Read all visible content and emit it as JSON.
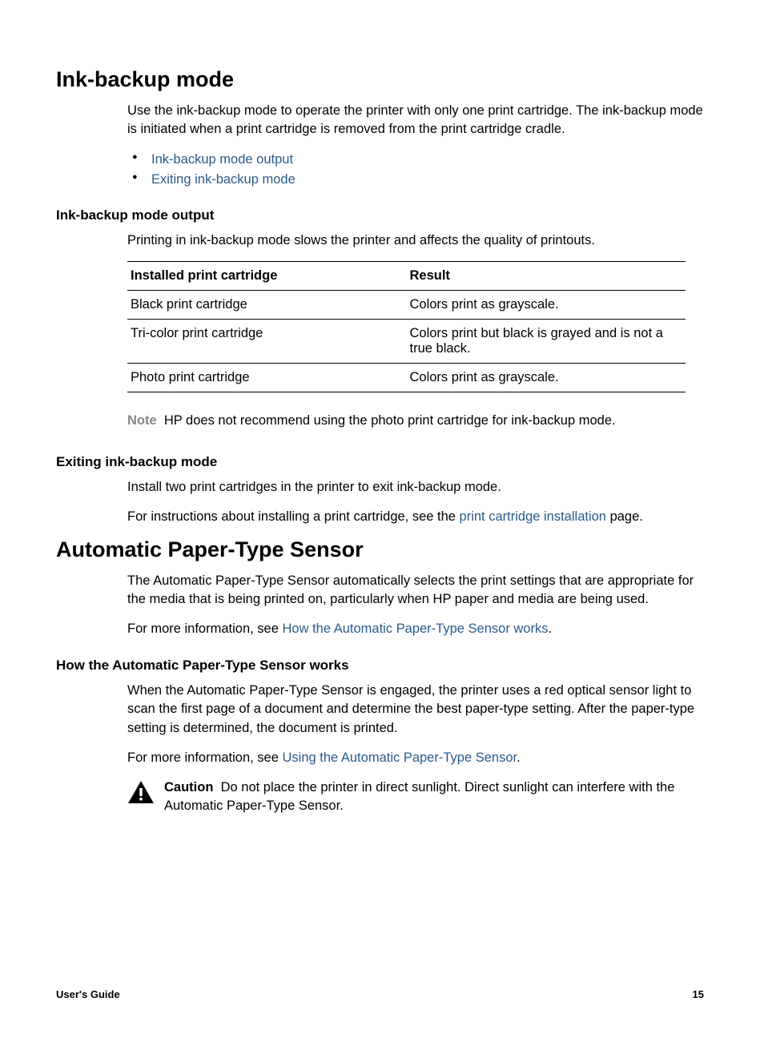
{
  "section1": {
    "title": "Ink-backup mode",
    "intro": "Use the ink-backup mode to operate the printer with only one print cartridge. The ink-backup mode is initiated when a print cartridge is removed from the print cartridge cradle.",
    "links": [
      "Ink-backup mode output",
      "Exiting ink-backup mode"
    ],
    "sub1": {
      "title": "Ink-backup mode output",
      "intro": "Printing in ink-backup mode slows the printer and affects the quality of printouts.",
      "table": {
        "headers": [
          "Installed print cartridge",
          "Result"
        ],
        "rows": [
          [
            "Black print cartridge",
            "Colors print as grayscale."
          ],
          [
            "Tri-color print cartridge",
            "Colors print but black is grayed and is not a true black."
          ],
          [
            "Photo print cartridge",
            "Colors print as grayscale."
          ]
        ]
      },
      "note_label": "Note",
      "note_text": "HP does not recommend using the photo print cartridge for ink-backup mode."
    },
    "sub2": {
      "title": "Exiting ink-backup mode",
      "p1": "Install two print cartridges in the printer to exit ink-backup mode.",
      "p2_pre": "For instructions about installing a print cartridge, see the ",
      "p2_link": "print cartridge installation",
      "p2_post": " page."
    }
  },
  "section2": {
    "title": "Automatic Paper-Type Sensor",
    "intro": "The Automatic Paper-Type Sensor automatically selects the print settings that are appropriate for the media that is being printed on, particularly when HP paper and media are being used.",
    "more_pre": "For more information, see ",
    "more_link": "How the Automatic Paper-Type Sensor works",
    "more_post": ".",
    "sub1": {
      "title": "How the Automatic Paper-Type Sensor works",
      "p1": "When the Automatic Paper-Type Sensor is engaged, the printer uses a red optical sensor light to scan the first page of a document and determine the best paper-type setting. After the paper-type setting is determined, the document is printed.",
      "p2_pre": "For more information, see ",
      "p2_link": "Using the Automatic Paper-Type Sensor",
      "p2_post": ".",
      "caution_label": "Caution",
      "caution_text": "Do not place the printer in direct sunlight. Direct sunlight can interfere with the Automatic Paper-Type Sensor."
    }
  },
  "footer": {
    "left": "User's Guide",
    "right": "15"
  }
}
